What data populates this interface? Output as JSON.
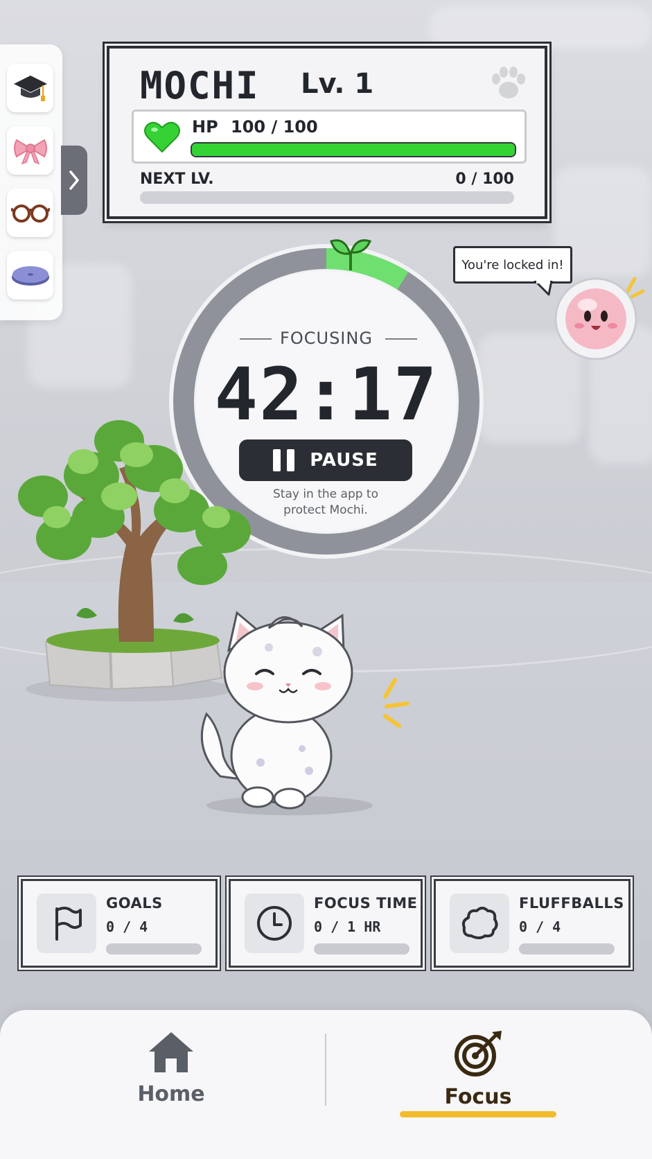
{
  "sidebar": {
    "items": [
      {
        "icon": "graduation-cap-icon"
      },
      {
        "icon": "bow-icon"
      },
      {
        "icon": "glasses-icon"
      },
      {
        "icon": "cushion-icon"
      }
    ],
    "toggle_icon": "chevron-right-icon"
  },
  "status": {
    "name": "MOCHI",
    "level": "Lv. 1",
    "hp_label": "HP",
    "hp_value": "100 / 100",
    "hp_fraction": 1.0,
    "next_label": "NEXT LV.",
    "next_value": "0 / 100",
    "xp_fraction": 0.0,
    "hp_color": "#34d334"
  },
  "timer": {
    "state_label": "FOCUSING",
    "time": "42:17",
    "pause_label": "PAUSE",
    "hint": "Stay in the app to protect Mochi.",
    "progress_fraction": 0.09,
    "progress_color": "#6fe06f"
  },
  "companion": {
    "speech": "You're locked in!"
  },
  "stats": [
    {
      "title": "GOALS",
      "value": "0 / 4",
      "fraction": 0.0,
      "icon": "flag-icon"
    },
    {
      "title": "FOCUS TIME",
      "value": "0 / 1 HR",
      "fraction": 0.0,
      "icon": "clock-icon"
    },
    {
      "title": "FLUFFBALLS",
      "value": "0 / 4",
      "fraction": 0.0,
      "icon": "cloud-icon"
    }
  ],
  "nav": {
    "home_label": "Home",
    "focus_label": "Focus",
    "active": "Focus",
    "accent": "#f1bb2c"
  }
}
